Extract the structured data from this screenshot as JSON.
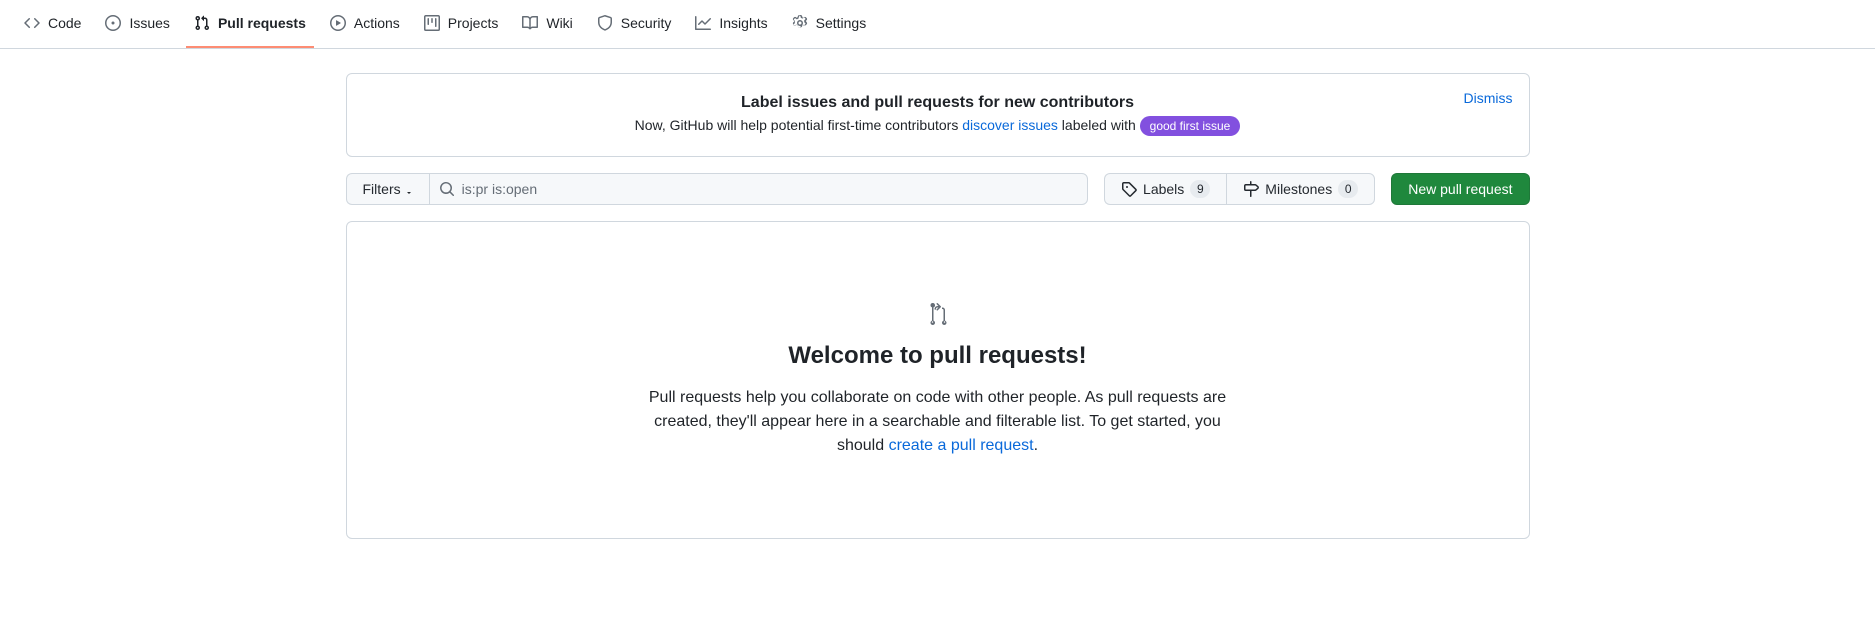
{
  "tabs": [
    {
      "label": "Code"
    },
    {
      "label": "Issues"
    },
    {
      "label": "Pull requests"
    },
    {
      "label": "Actions"
    },
    {
      "label": "Projects"
    },
    {
      "label": "Wiki"
    },
    {
      "label": "Security"
    },
    {
      "label": "Insights"
    },
    {
      "label": "Settings"
    }
  ],
  "flash": {
    "title": "Label issues and pull requests for new contributors",
    "sub_before": "Now, GitHub will help potential first-time contributors ",
    "sub_link": "discover issues",
    "sub_after": " labeled with ",
    "pill": "good first issue",
    "dismiss": "Dismiss"
  },
  "toolbar": {
    "filters": "Filters",
    "search_value": "is:pr is:open",
    "labels_label": "Labels",
    "labels_count": "9",
    "milestones_label": "Milestones",
    "milestones_count": "0",
    "new_pr": "New pull request"
  },
  "blank": {
    "heading": "Welcome to pull requests!",
    "body_before": "Pull requests help you collaborate on code with other people. As pull requests are created, they'll appear here in a searchable and filterable list. To get started, you should ",
    "body_link": "create a pull request",
    "body_after": "."
  }
}
